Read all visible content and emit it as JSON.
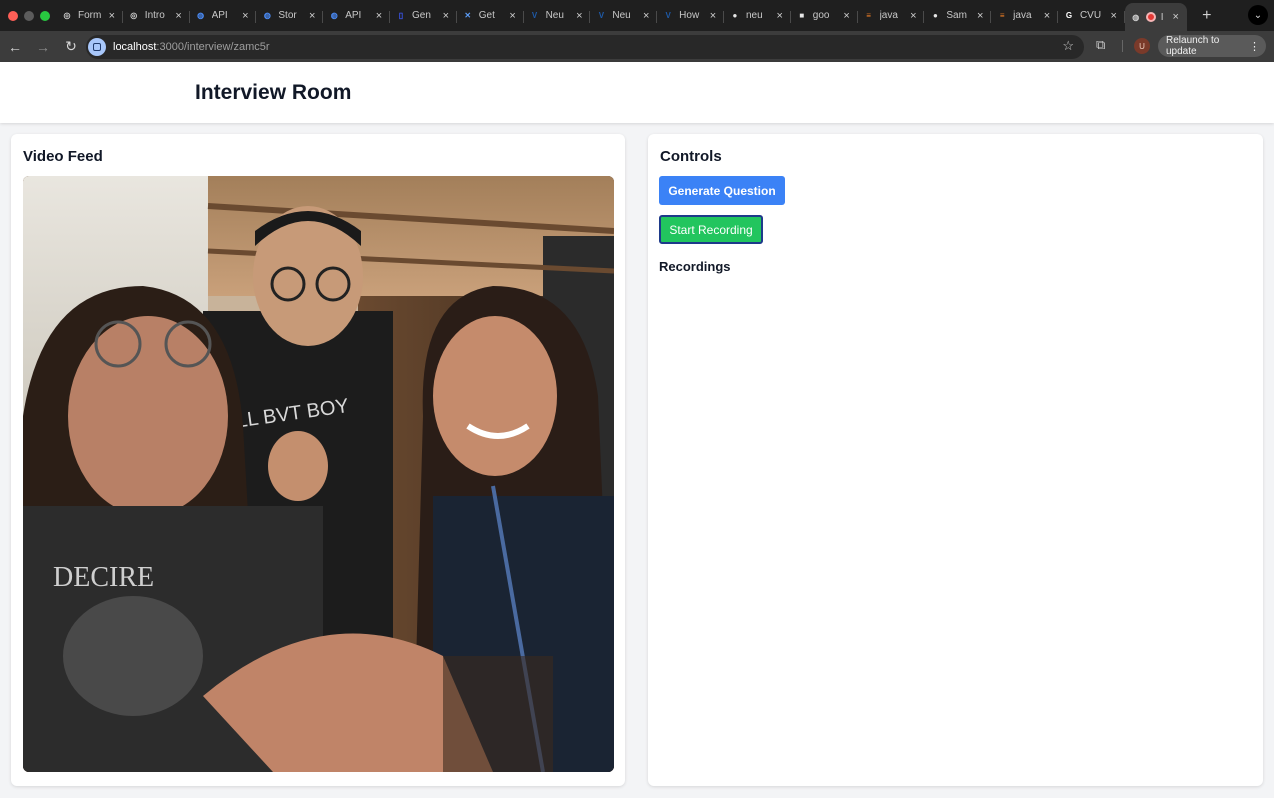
{
  "browser": {
    "tabs": [
      {
        "title": "Form",
        "icon": "openai-icon",
        "color": "#cfcfcf"
      },
      {
        "title": "Intro",
        "icon": "openai-icon",
        "color": "#cfcfcf"
      },
      {
        "title": "API",
        "icon": "globe-icon",
        "color": "#4a8af4"
      },
      {
        "title": "Stor",
        "icon": "globe-icon",
        "color": "#4a8af4"
      },
      {
        "title": "API",
        "icon": "globe-icon",
        "color": "#4a8af4"
      },
      {
        "title": "Gen",
        "icon": "page-icon",
        "color": "#3d5afe"
      },
      {
        "title": "Get",
        "icon": "butterfly-icon",
        "color": "#5b9cf6"
      },
      {
        "title": "Neu",
        "icon": "v-logo-icon",
        "color": "#1e5aa8"
      },
      {
        "title": "Neu",
        "icon": "v-logo-icon",
        "color": "#1e5aa8"
      },
      {
        "title": "How",
        "icon": "v-logo-icon",
        "color": "#1e5aa8"
      },
      {
        "title": "neu",
        "icon": "github-icon",
        "color": "#e6e6e6"
      },
      {
        "title": "goo",
        "icon": "cube-icon",
        "color": "#e6e6e6"
      },
      {
        "title": "java",
        "icon": "stackoverflow-icon",
        "color": "#f48024"
      },
      {
        "title": "Sam",
        "icon": "github-icon",
        "color": "#e6e6e6"
      },
      {
        "title": "java",
        "icon": "stackoverflow-icon",
        "color": "#f48024"
      },
      {
        "title": "CVU",
        "icon": "google-icon",
        "color": "#ffffff"
      },
      {
        "title": "I",
        "icon": "globe-icon",
        "color": "#cfcfcf",
        "active": true
      }
    ],
    "url_host": "localhost",
    "url_path": ":3000/interview/zamc5r",
    "relaunch_label": "Relaunch to update",
    "avatar_letter": "U"
  },
  "page": {
    "title": "Interview Room"
  },
  "video_card": {
    "title": "Video Feed"
  },
  "controls_card": {
    "title": "Controls",
    "generate_label": "Generate Question",
    "record_label": "Start Recording",
    "recordings_title": "Recordings"
  },
  "colors": {
    "accent_blue": "#3b82f6",
    "record_green": "#22c55e",
    "focus_ring": "#1e3a8a"
  }
}
